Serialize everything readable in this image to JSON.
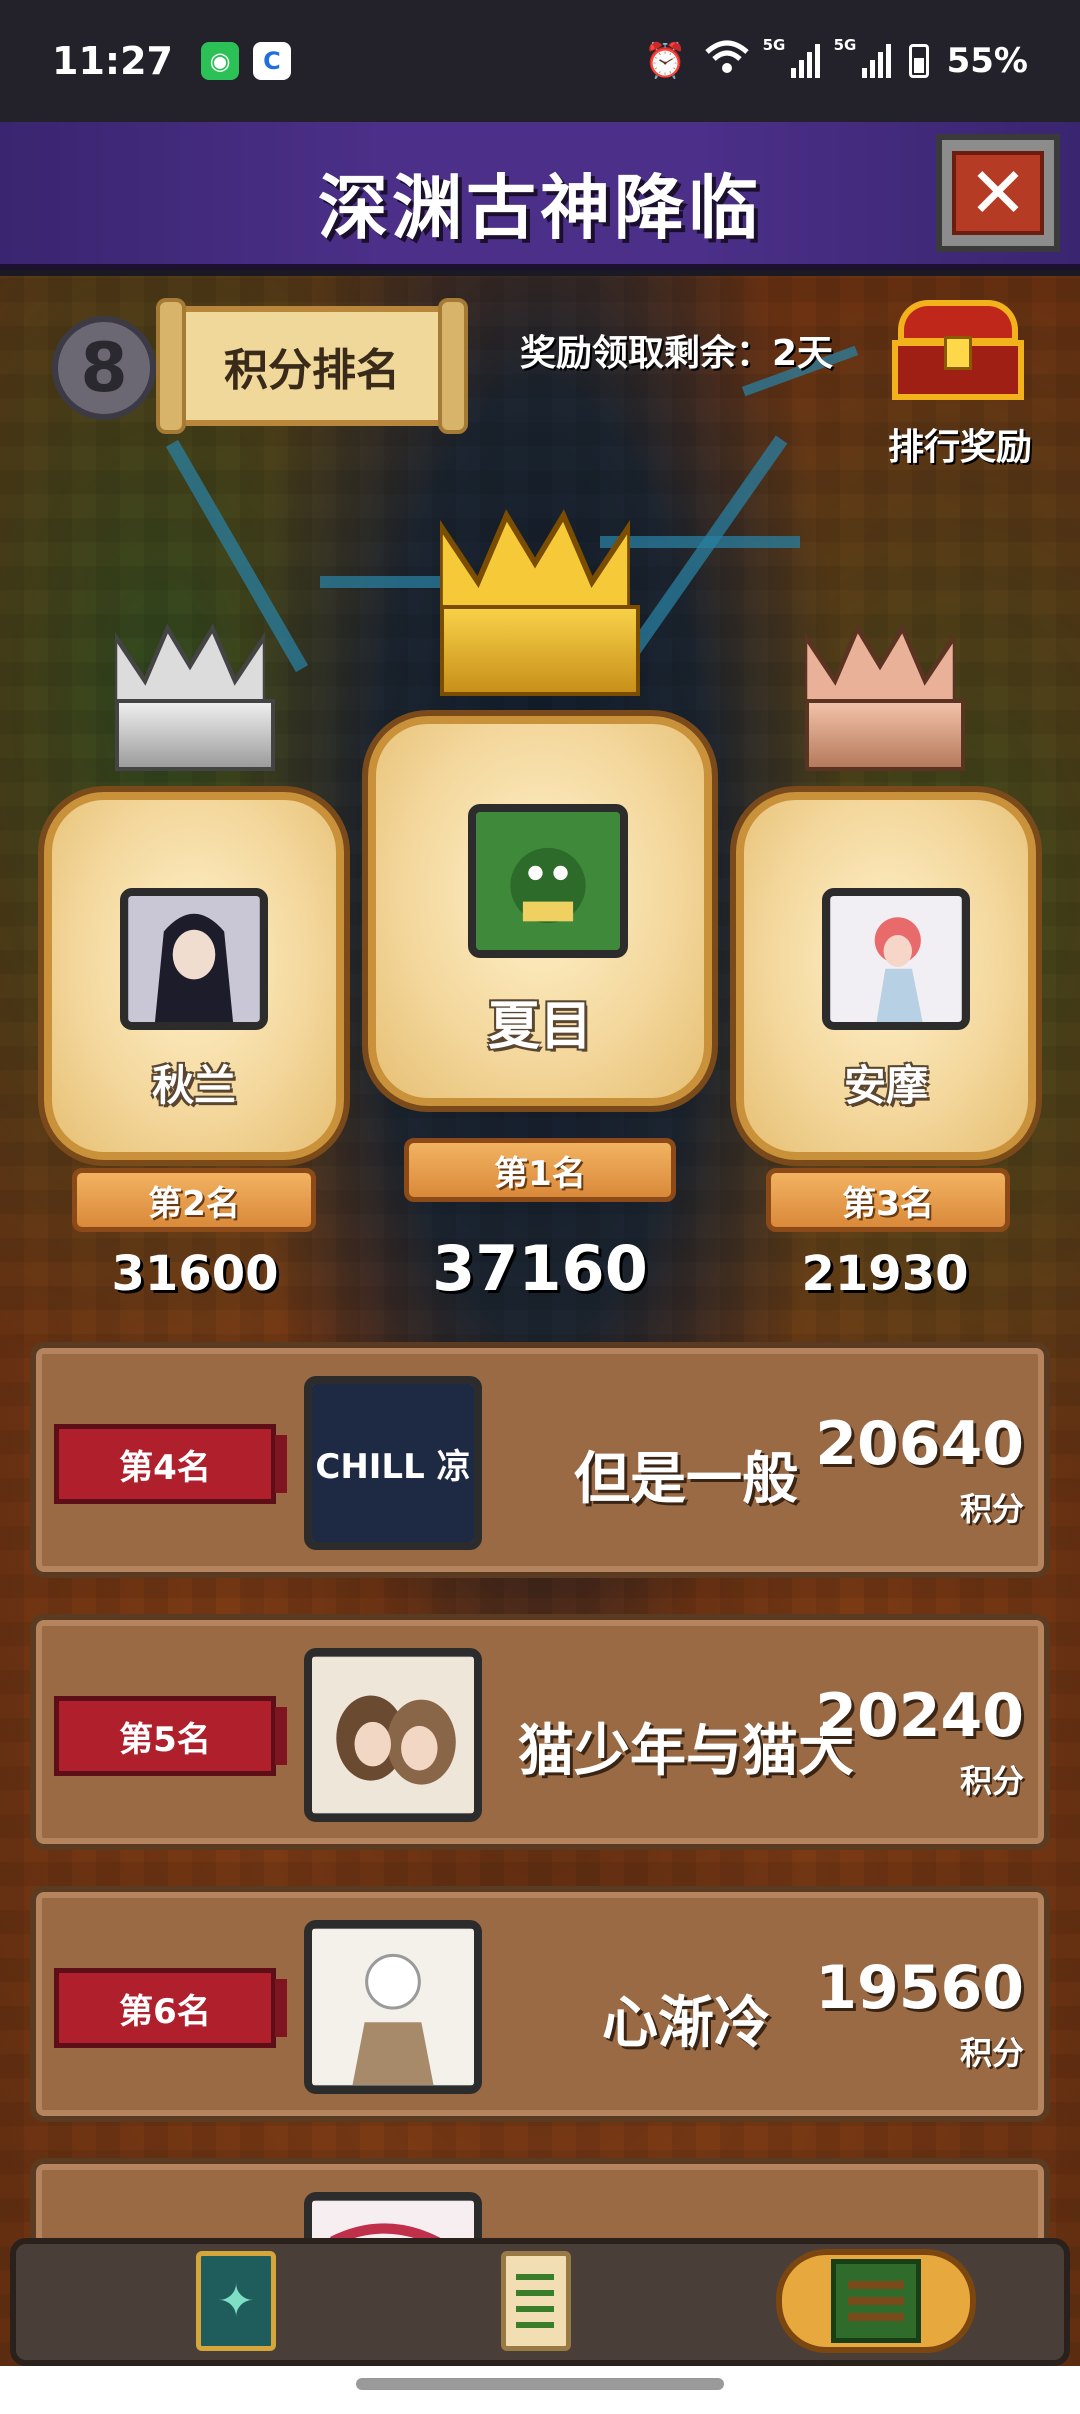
{
  "status_bar": {
    "time": "11:27",
    "signal_1_tag": "5G",
    "signal_2_tag": "5G",
    "battery": "55%",
    "icons": [
      "wechat-icon",
      "c-app-icon",
      "alarm-icon",
      "wifi-icon",
      "signal-icon",
      "signal-icon",
      "battery-icon"
    ]
  },
  "header": {
    "title": "深渊古神降临",
    "close_symbol": "✕"
  },
  "top": {
    "rank_badge": "8",
    "tab_label": "积分排名",
    "reward_remaining": "奖励领取剩余：2天",
    "chest_label": "排行奖励"
  },
  "podium": {
    "first": {
      "name": "夏目",
      "rank": "第1名",
      "score": "37160"
    },
    "second": {
      "name": "秋兰",
      "rank": "第2名",
      "score": "31600"
    },
    "third": {
      "name": "安摩",
      "rank": "第3名",
      "score": "21930"
    }
  },
  "rows": [
    {
      "rank": "第4名",
      "name": "但是一般",
      "score": "20640",
      "unit": "积分",
      "avatar_text": "CHILL 凉"
    },
    {
      "rank": "第5名",
      "name": "猫少年与猫大",
      "score": "20240",
      "unit": "积分"
    },
    {
      "rank": "第6名",
      "name": "心渐冷",
      "score": "19560",
      "unit": "积分"
    },
    {
      "rank": "",
      "name": "",
      "score": "",
      "unit": ""
    }
  ],
  "bottom_nav": [
    "card-icon",
    "quest-scroll-icon",
    "ranking-gate-icon"
  ],
  "colors": {
    "title_bar": "#4b2f88",
    "row_bg": "#9a6a45",
    "rank_tag_red": "#b01f2c",
    "podium_card": "#f3d69a"
  }
}
